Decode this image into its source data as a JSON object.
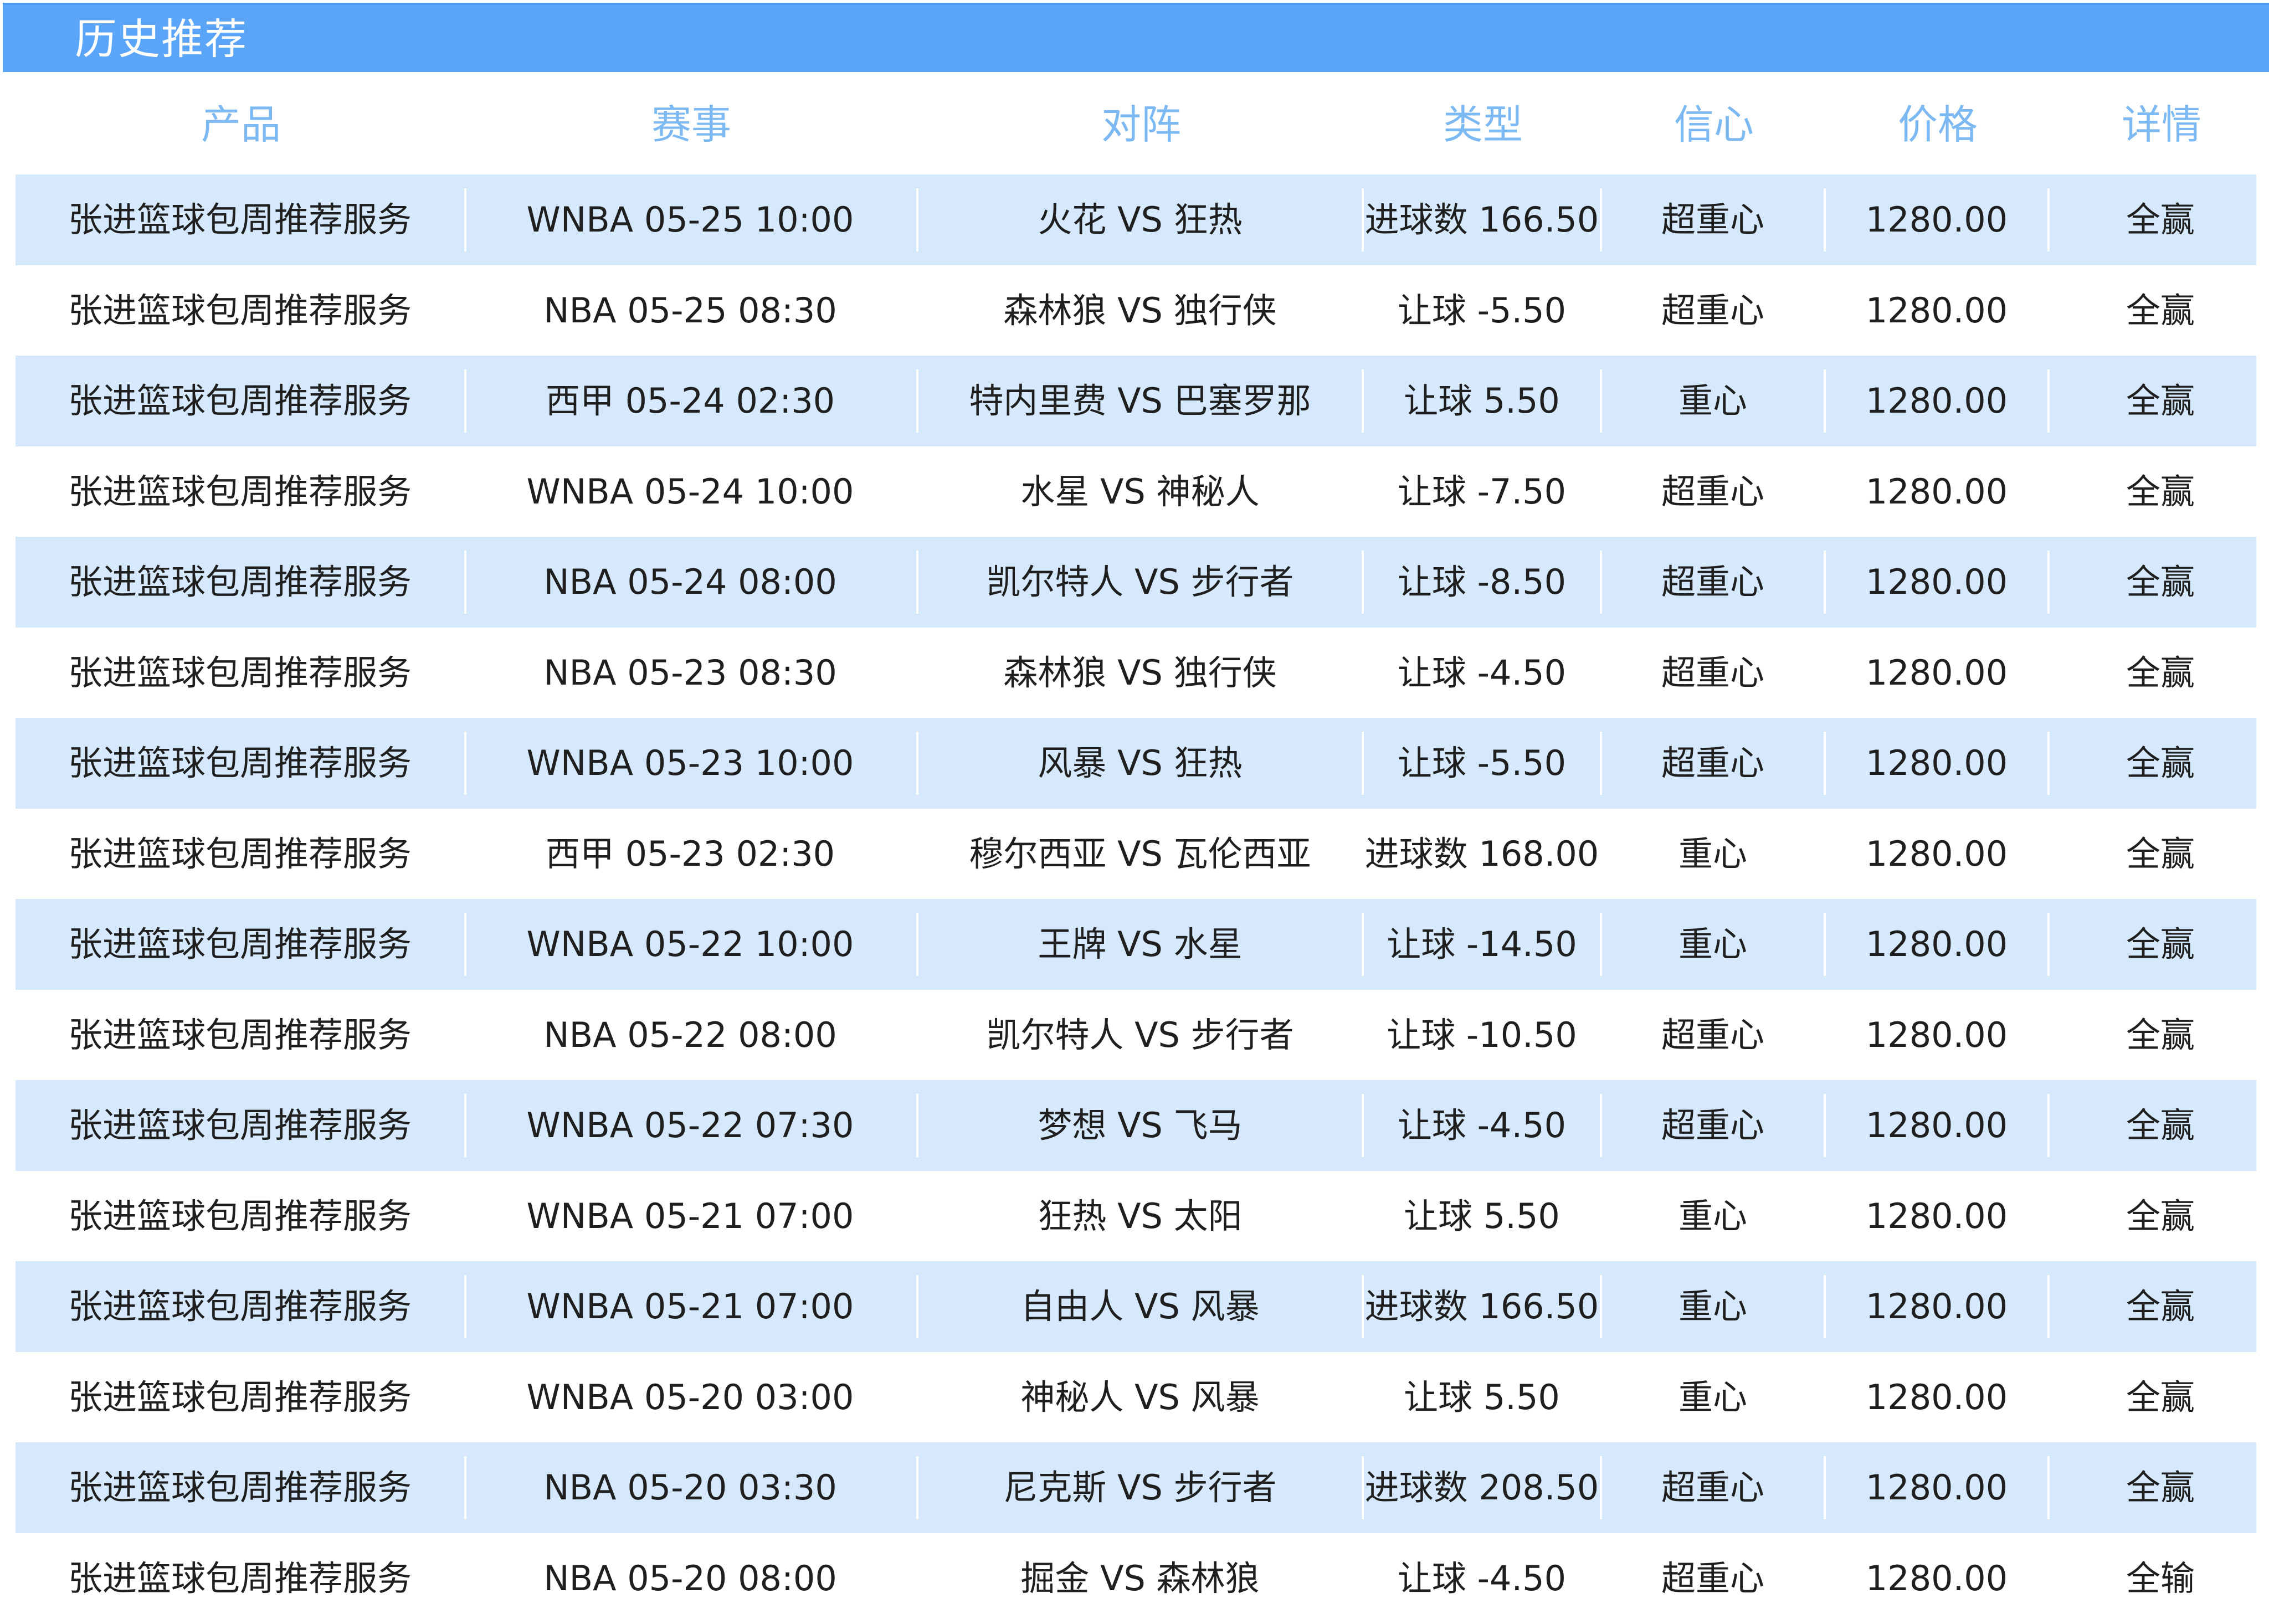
{
  "title": "历史推荐",
  "columns": [
    "产品",
    "赛事",
    "对阵",
    "类型",
    "信心",
    "价格",
    "详情"
  ],
  "rows": [
    {
      "product": "张进篮球包周推荐服务",
      "event": "WNBA 05-25 10:00",
      "match": "火花 VS 狂热",
      "type": "进球数 166.50",
      "confidence": "超重心",
      "price": "1280.00",
      "detail": "全赢"
    },
    {
      "product": "张进篮球包周推荐服务",
      "event": "NBA 05-25 08:30",
      "match": "森林狼 VS 独行侠",
      "type": "让球 -5.50",
      "confidence": "超重心",
      "price": "1280.00",
      "detail": "全赢"
    },
    {
      "product": "张进篮球包周推荐服务",
      "event": "西甲 05-24 02:30",
      "match": "特内里费 VS 巴塞罗那",
      "type": "让球 5.50",
      "confidence": "重心",
      "price": "1280.00",
      "detail": "全赢"
    },
    {
      "product": "张进篮球包周推荐服务",
      "event": "WNBA 05-24 10:00",
      "match": "水星 VS 神秘人",
      "type": "让球 -7.50",
      "confidence": "超重心",
      "price": "1280.00",
      "detail": "全赢"
    },
    {
      "product": "张进篮球包周推荐服务",
      "event": "NBA 05-24 08:00",
      "match": "凯尔特人 VS 步行者",
      "type": "让球 -8.50",
      "confidence": "超重心",
      "price": "1280.00",
      "detail": "全赢"
    },
    {
      "product": "张进篮球包周推荐服务",
      "event": "NBA 05-23 08:30",
      "match": "森林狼 VS 独行侠",
      "type": "让球 -4.50",
      "confidence": "超重心",
      "price": "1280.00",
      "detail": "全赢"
    },
    {
      "product": "张进篮球包周推荐服务",
      "event": "WNBA 05-23 10:00",
      "match": "风暴 VS 狂热",
      "type": "让球 -5.50",
      "confidence": "超重心",
      "price": "1280.00",
      "detail": "全赢"
    },
    {
      "product": "张进篮球包周推荐服务",
      "event": "西甲 05-23 02:30",
      "match": "穆尔西亚 VS 瓦伦西亚",
      "type": "进球数 168.00",
      "confidence": "重心",
      "price": "1280.00",
      "detail": "全赢"
    },
    {
      "product": "张进篮球包周推荐服务",
      "event": "WNBA 05-22 10:00",
      "match": "王牌 VS 水星",
      "type": "让球 -14.50",
      "confidence": "重心",
      "price": "1280.00",
      "detail": "全赢"
    },
    {
      "product": "张进篮球包周推荐服务",
      "event": "NBA 05-22 08:00",
      "match": "凯尔特人 VS 步行者",
      "type": "让球 -10.50",
      "confidence": "超重心",
      "price": "1280.00",
      "detail": "全赢"
    },
    {
      "product": "张进篮球包周推荐服务",
      "event": "WNBA 05-22 07:30",
      "match": "梦想 VS 飞马",
      "type": "让球 -4.50",
      "confidence": "超重心",
      "price": "1280.00",
      "detail": "全赢"
    },
    {
      "product": "张进篮球包周推荐服务",
      "event": "WNBA 05-21 07:00",
      "match": "狂热 VS 太阳",
      "type": "让球 5.50",
      "confidence": "重心",
      "price": "1280.00",
      "detail": "全赢"
    },
    {
      "product": "张进篮球包周推荐服务",
      "event": "WNBA 05-21 07:00",
      "match": "自由人 VS 风暴",
      "type": "进球数 166.50",
      "confidence": "重心",
      "price": "1280.00",
      "detail": "全赢"
    },
    {
      "product": "张进篮球包周推荐服务",
      "event": "WNBA 05-20 03:00",
      "match": "神秘人 VS 风暴",
      "type": "让球 5.50",
      "confidence": "重心",
      "price": "1280.00",
      "detail": "全赢"
    },
    {
      "product": "张进篮球包周推荐服务",
      "event": "NBA 05-20 03:30",
      "match": "尼克斯 VS 步行者",
      "type": "进球数 208.50",
      "confidence": "超重心",
      "price": "1280.00",
      "detail": "全赢"
    },
    {
      "product": "张进篮球包周推荐服务",
      "event": "NBA 05-20 08:00",
      "match": "掘金 VS 森林狼",
      "type": "让球 -4.50",
      "confidence": "超重心",
      "price": "1280.00",
      "detail": "全输"
    }
  ]
}
